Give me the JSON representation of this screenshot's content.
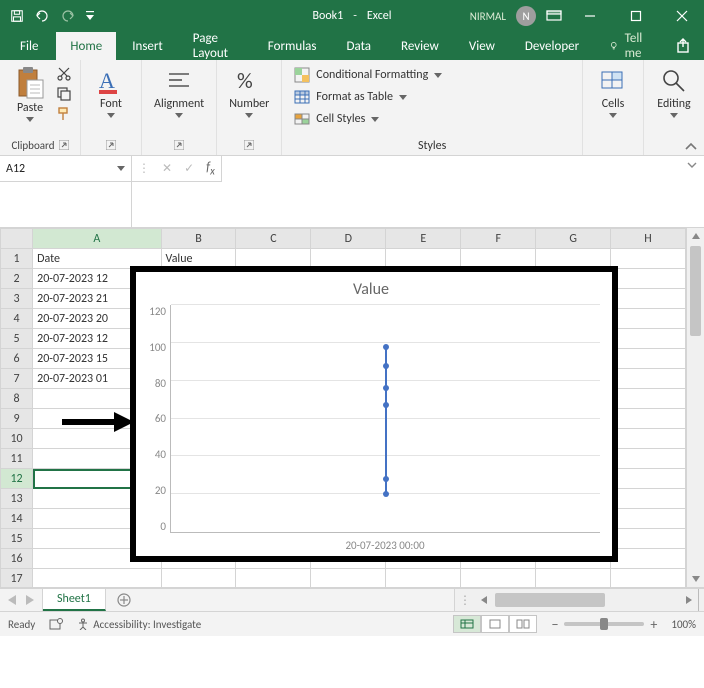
{
  "titlebar": {
    "book_name": "Book1",
    "app_name": "Excel",
    "user": "NIRMAL",
    "avatar_initial": "N"
  },
  "tabs": {
    "file": "File",
    "home": "Home",
    "insert": "Insert",
    "page_layout": "Page Layout",
    "formulas": "Formulas",
    "data": "Data",
    "review": "Review",
    "view": "View",
    "developer": "Developer",
    "tellme": "Tell me"
  },
  "ribbon": {
    "clipboard": {
      "paste": "Paste",
      "label": "Clipboard"
    },
    "font": {
      "btn": "Font"
    },
    "alignment": {
      "btn": "Alignment"
    },
    "number": {
      "btn": "Number"
    },
    "styles": {
      "cond": "Conditional Formatting",
      "table": "Format as Table",
      "cell": "Cell Styles",
      "label": "Styles"
    },
    "cells": {
      "btn": "Cells"
    },
    "editing": {
      "btn": "Editing"
    }
  },
  "name_box": "A12",
  "columns": [
    "A",
    "B",
    "C",
    "D",
    "E",
    "F",
    "G",
    "H"
  ],
  "rows": {
    "header": {
      "A": "Date",
      "B": "Value"
    },
    "data": [
      {
        "row": 2,
        "A": "20-07-2023 12"
      },
      {
        "row": 3,
        "A": "20-07-2023 21"
      },
      {
        "row": 4,
        "A": "20-07-2023 20"
      },
      {
        "row": 5,
        "A": "20-07-2023 12"
      },
      {
        "row": 6,
        "A": "20-07-2023 15"
      },
      {
        "row": 7,
        "A": "20-07-2023 01"
      }
    ],
    "empty": [
      8,
      9,
      10,
      11,
      12,
      13,
      14,
      15,
      16,
      17
    ],
    "selected_row": 12
  },
  "chart_data": {
    "type": "line",
    "title": "Value",
    "xlabel": "",
    "xtick": "20-07-2023 00:00",
    "ylabel": "",
    "ylim": [
      0,
      120
    ],
    "yticks": [
      0,
      20,
      40,
      60,
      80,
      100,
      120
    ],
    "series": [
      {
        "name": "Value",
        "x": [
          "20-07-2023"
        ],
        "values": [
          20,
          28,
          67,
          76,
          88,
          98
        ]
      }
    ]
  },
  "sheet_tab": "Sheet1",
  "status": {
    "ready": "Ready",
    "accessibility": "Accessibility: Investigate",
    "zoom": "100%"
  }
}
